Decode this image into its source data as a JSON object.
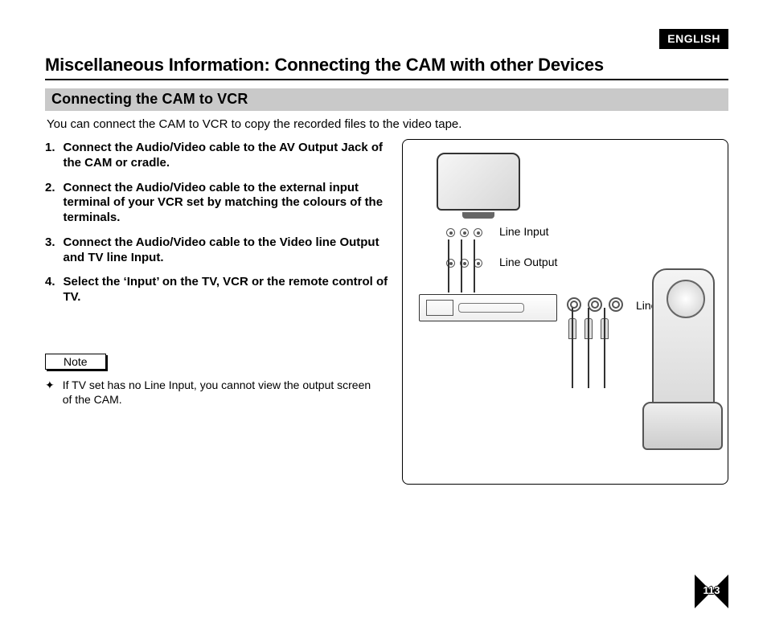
{
  "language_badge": "ENGLISH",
  "title": "Miscellaneous Information: Connecting the CAM with other Devices",
  "subheading": "Connecting the CAM to VCR",
  "intro": "You can connect the CAM to VCR to copy the recorded files to the video tape.",
  "steps": [
    "Connect the Audio/Video cable to the AV Output Jack of the CAM or cradle.",
    "Connect the Audio/Video cable to the external input terminal of your VCR set by matching the colours of the terminals.",
    "Connect the Audio/Video cable to the Video line Output and TV line Input.",
    "Select the ‘Input’ on the TV, VCR or the remote control of TV."
  ],
  "note_label": "Note",
  "note_bullet": "✦",
  "note_text": "If TV set has no Line Input, you cannot view the output screen of the CAM.",
  "figure": {
    "label_tv_input": "Line Input",
    "label_tv_output": "Line Output",
    "label_vcr_input": "Line Input"
  },
  "page_number": "113"
}
